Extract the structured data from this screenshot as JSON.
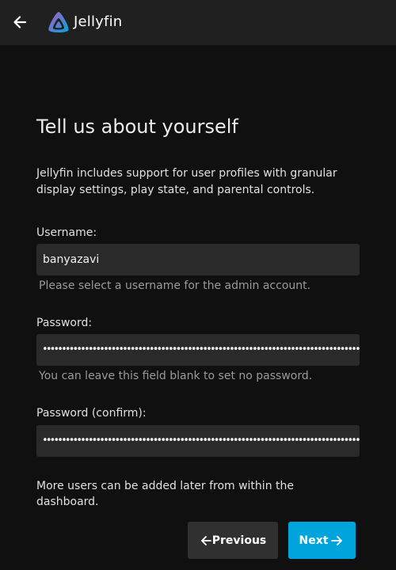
{
  "header": {
    "title": "Jellyfin",
    "back_icon": "arrow-left-icon",
    "logo_icon": "jellyfin-logo-icon"
  },
  "wizard": {
    "title": "Tell us about yourself",
    "intro": "Jellyfin includes support for user profiles with granular display settings, play state, and parental controls.",
    "username": {
      "label": "Username:",
      "value": "banyazavi",
      "hint": "Please select a username for the admin account."
    },
    "password": {
      "label": "Password:",
      "masked": "••••••••••••••••••••••••••••••••••••••••••••••••••••••••••••••••••••••••••••••••••••••••••••••••••••••••••••••",
      "hint": "You can leave this field blank to set no password."
    },
    "password_confirm": {
      "label": "Password (confirm):",
      "masked": "••••••••••••••••••••••••••••••••••••••••••••••••••••••••••••••••••••••••••••••••••••••••••••••••••••••••••••••"
    },
    "footer_note": "More users can be added later from within the dashboard.",
    "previous_label": "Previous",
    "next_label": "Next"
  },
  "colors": {
    "accent": "#00a4dc",
    "background": "#101010",
    "header": "#202020",
    "input": "#2a2a2a"
  }
}
